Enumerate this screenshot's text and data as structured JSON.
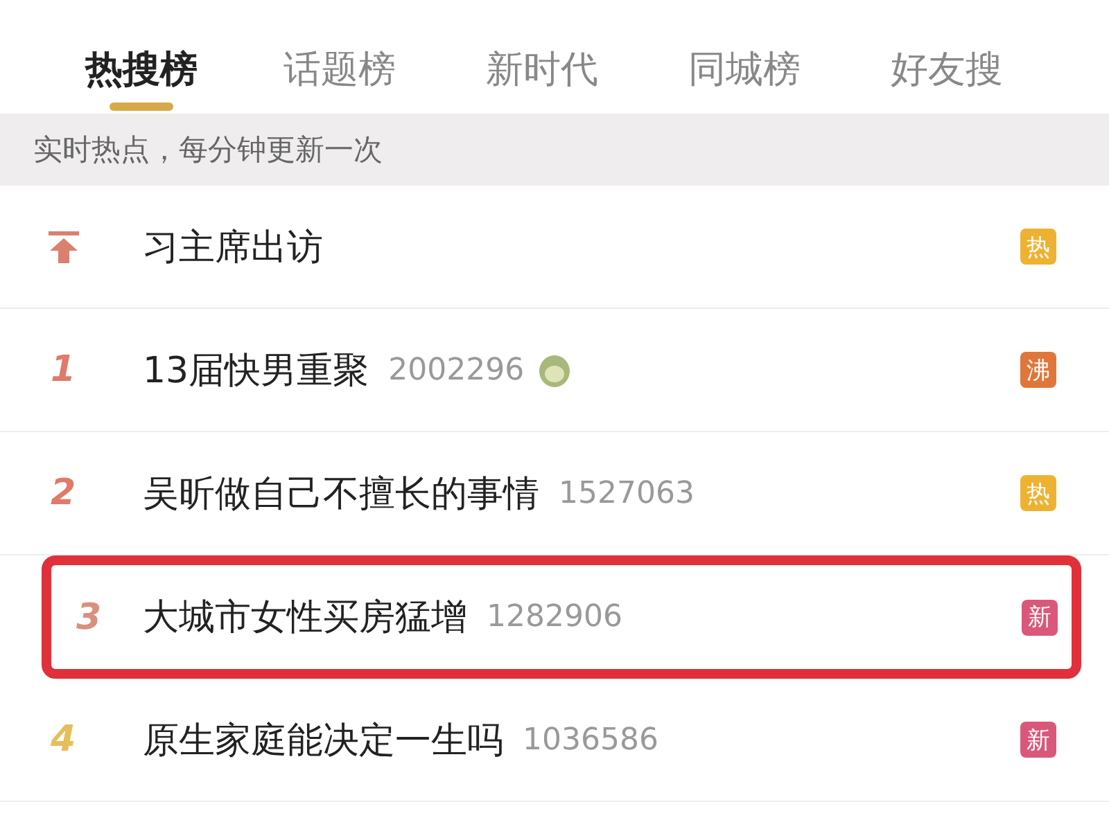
{
  "tabs": [
    {
      "label": "热搜榜",
      "selected": true
    },
    {
      "label": "话题榜",
      "selected": false
    },
    {
      "label": "新时代",
      "selected": false
    },
    {
      "label": "同城榜",
      "selected": false
    },
    {
      "label": "好友搜",
      "selected": false
    }
  ],
  "notice": "实时热点，每分钟更新一次",
  "rows": [
    {
      "kind": "pinned",
      "title": "习主席出访",
      "badge": {
        "text": "热",
        "color": "#eeb233"
      },
      "circled": false,
      "emoji": false
    },
    {
      "kind": "ranked",
      "rank": {
        "text": "1",
        "color": "#e07a6a"
      },
      "title": "13届快男重聚",
      "count": "2002296",
      "emoji": true,
      "badge": {
        "text": "沸",
        "color": "#e0763a"
      },
      "circled": false
    },
    {
      "kind": "ranked",
      "rank": {
        "text": "2",
        "color": "#e07a6a"
      },
      "title": "吴昕做自己不擅长的事情",
      "count": "1527063",
      "emoji": false,
      "badge": {
        "text": "热",
        "color": "#eeb233"
      },
      "circled": false
    },
    {
      "kind": "ranked",
      "rank": {
        "text": "3",
        "color": "#d9907f"
      },
      "title": "大城市女性买房猛增",
      "count": "1282906",
      "emoji": false,
      "badge": {
        "text": "新",
        "color": "#d9587a"
      },
      "circled": true
    },
    {
      "kind": "ranked",
      "rank": {
        "text": "4",
        "color": "#e6be5a"
      },
      "title": "原生家庭能决定一生吗",
      "count": "1036586",
      "emoji": false,
      "badge": {
        "text": "新",
        "color": "#d9587a"
      },
      "circled": false
    }
  ]
}
